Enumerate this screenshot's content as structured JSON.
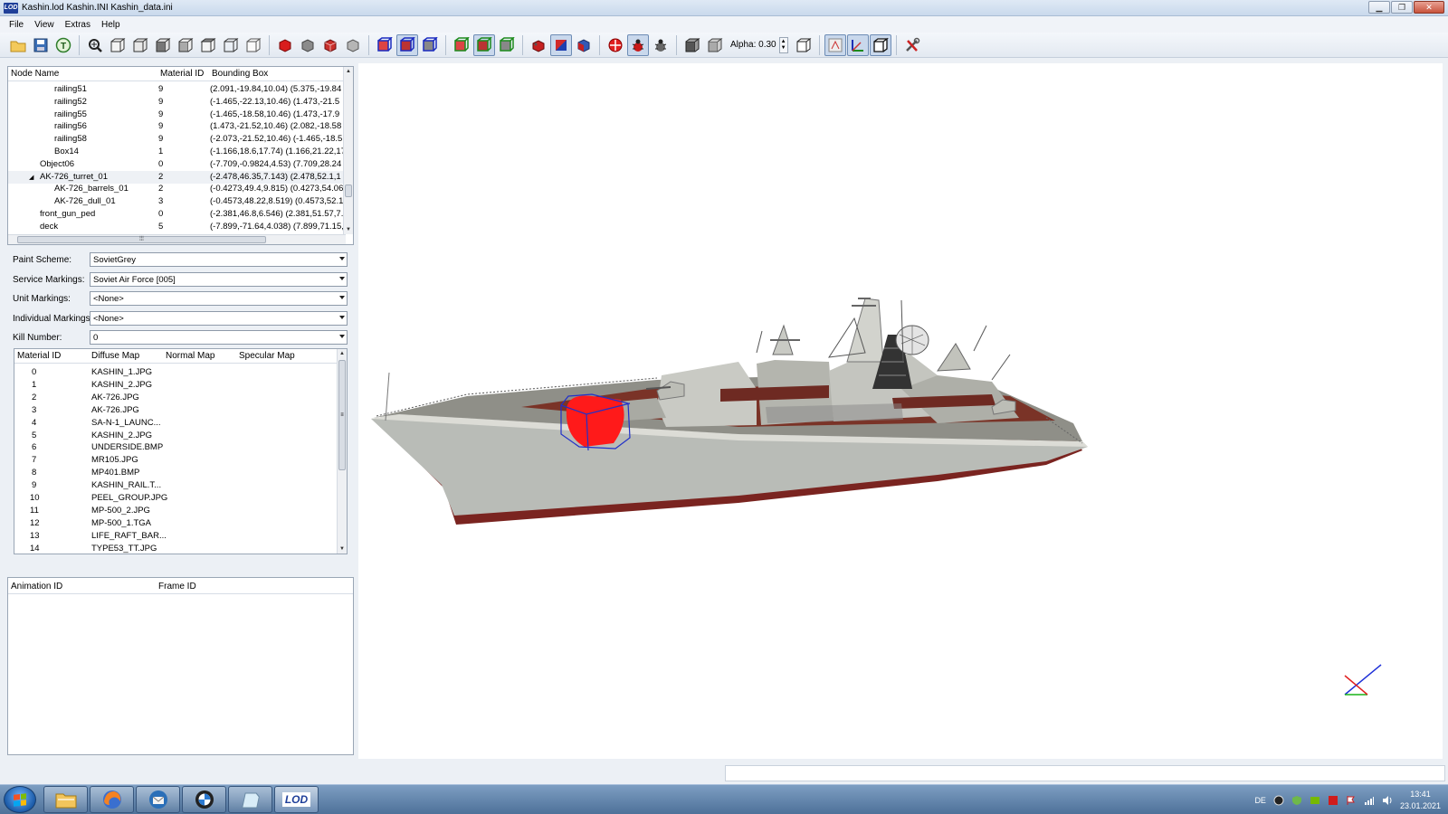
{
  "window": {
    "title": "Kashin.lod  Kashin.INI  Kashin_data.ini",
    "app_badge": "LOD"
  },
  "menu": [
    "File",
    "View",
    "Extras",
    "Help"
  ],
  "toolbar": {
    "alpha_label": "Alpha: 0.30"
  },
  "node_tree": {
    "columns": [
      "Node Name",
      "Material ID",
      "Bounding Box"
    ],
    "rows": [
      {
        "name": "railing51",
        "mat": "9",
        "bbox": "(2.091,-19.84,10.04) (5.375,-19.84",
        "indent": 2
      },
      {
        "name": "railing52",
        "mat": "9",
        "bbox": "(-1.465,-22.13,10.46) (1.473,-21.5",
        "indent": 2
      },
      {
        "name": "railing55",
        "mat": "9",
        "bbox": "(-1.465,-18.58,10.46) (1.473,-17.9",
        "indent": 2
      },
      {
        "name": "railing56",
        "mat": "9",
        "bbox": "(1.473,-21.52,10.46) (2.082,-18.58",
        "indent": 2
      },
      {
        "name": "railing58",
        "mat": "9",
        "bbox": "(-2.073,-21.52,10.46) (-1.465,-18.5",
        "indent": 2
      },
      {
        "name": "Box14",
        "mat": "1",
        "bbox": "(-1.166,18.6,17.74) (1.166,21.22,17",
        "indent": 2
      },
      {
        "name": "Object06",
        "mat": "0",
        "bbox": "(-7.709,-0.9824,4.53) (7.709,28.24",
        "indent": 1
      },
      {
        "name": "AK-726_turret_01",
        "mat": "2",
        "bbox": "(-2.478,46.35,7.143) (2.478,52.1,1",
        "indent": 1,
        "expanded": true,
        "selected": true
      },
      {
        "name": "AK-726_barrels_01",
        "mat": "2",
        "bbox": "(-0.4273,49.4,9.815) (0.4273,54.06",
        "indent": 2
      },
      {
        "name": "AK-726_dull_01",
        "mat": "3",
        "bbox": "(-0.4573,48.22,8.519) (0.4573,52.1",
        "indent": 2
      },
      {
        "name": "front_gun_ped",
        "mat": "0",
        "bbox": "(-2.381,46.8,6.546) (2.381,51.57,7.",
        "indent": 1
      },
      {
        "name": "deck",
        "mat": "5",
        "bbox": "(-7.899,-71.64,4.038) (7.899,71.15,",
        "indent": 1
      }
    ]
  },
  "properties": [
    {
      "label": "Paint Scheme:",
      "value": "SovietGrey"
    },
    {
      "label": "Service Markings:",
      "value": "Soviet Air Force [005]"
    },
    {
      "label": "Unit Markings:",
      "value": "<None>"
    },
    {
      "label": "Individual Markings:",
      "value": "<None>"
    },
    {
      "label": "Kill Number:",
      "value": "0"
    }
  ],
  "materials": {
    "columns": [
      "Material ID",
      "Diffuse Map",
      "Normal Map",
      "Specular Map"
    ],
    "rows": [
      {
        "id": "0",
        "diffuse": "KASHIN_1.JPG"
      },
      {
        "id": "1",
        "diffuse": "KASHIN_2.JPG"
      },
      {
        "id": "2",
        "diffuse": "AK-726.JPG"
      },
      {
        "id": "3",
        "diffuse": "AK-726.JPG"
      },
      {
        "id": "4",
        "diffuse": "SA-N-1_LAUNC..."
      },
      {
        "id": "5",
        "diffuse": "KASHIN_2.JPG"
      },
      {
        "id": "6",
        "diffuse": "UNDERSIDE.BMP"
      },
      {
        "id": "7",
        "diffuse": "MR105.JPG"
      },
      {
        "id": "8",
        "diffuse": "MP401.BMP"
      },
      {
        "id": "9",
        "diffuse": "KASHIN_RAIL.T..."
      },
      {
        "id": "10",
        "diffuse": "PEEL_GROUP.JPG"
      },
      {
        "id": "11",
        "diffuse": "MP-500_2.JPG"
      },
      {
        "id": "12",
        "diffuse": "MP-500_1.TGA"
      },
      {
        "id": "13",
        "diffuse": "LIFE_RAFT_BAR..."
      },
      {
        "id": "14",
        "diffuse": "TYPE53_TT.JPG"
      }
    ]
  },
  "animations": {
    "columns": [
      "Animation ID",
      "Frame ID"
    ]
  },
  "taskbar": {
    "apps": [
      "explorer",
      "firefox",
      "thunderbird",
      "bmw",
      "notepad",
      "lod"
    ],
    "app_badge": "LOD",
    "lang": "DE",
    "time": "13:41",
    "date": "23.01.2021"
  },
  "colors": {
    "hull_red": "#7a2420",
    "hull_grey": "#b9bcb7",
    "highlight": "#ff1010",
    "accent": "#1f3f99"
  }
}
